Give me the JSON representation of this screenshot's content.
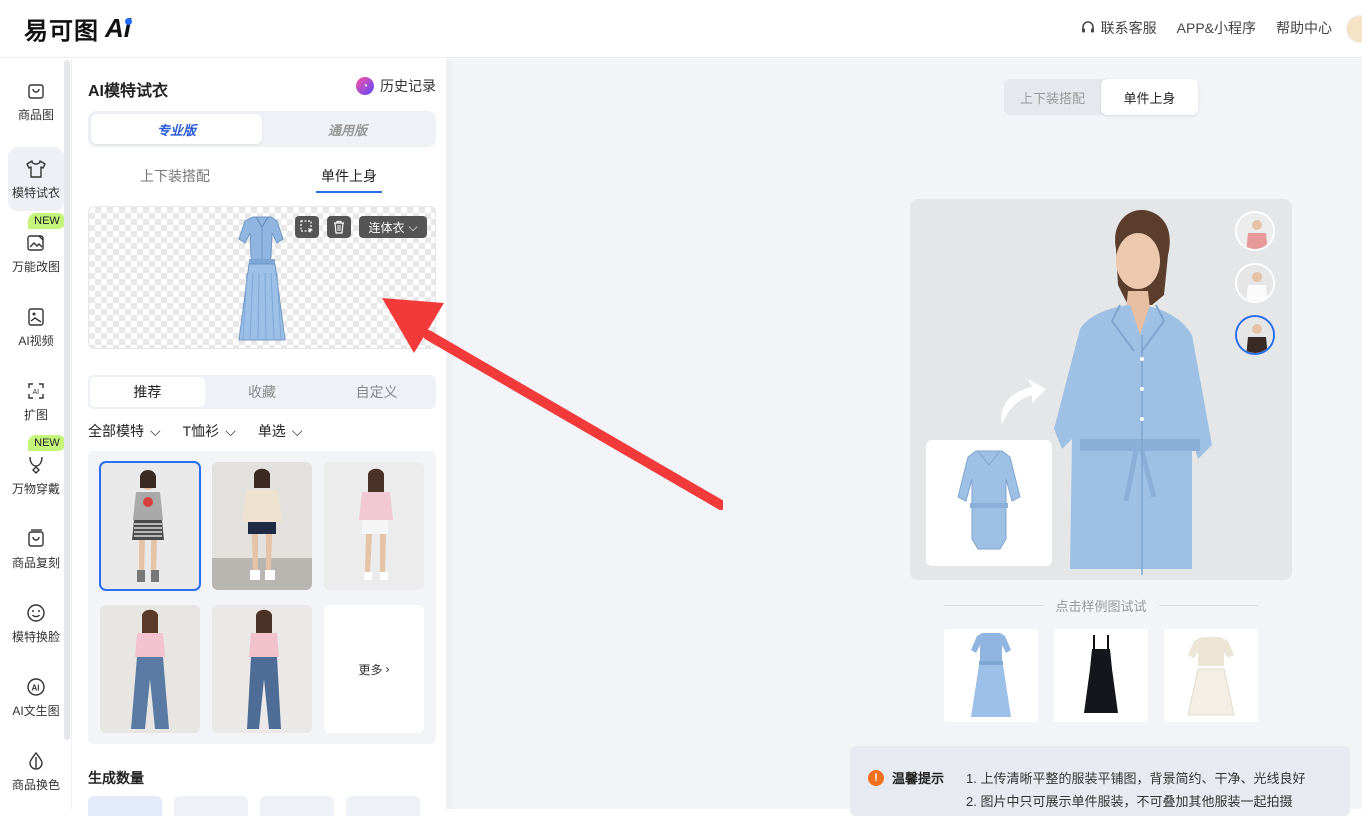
{
  "brand": {
    "logo_text": "易可图",
    "logo_ai": "Ai"
  },
  "topnav": {
    "contact": "联系客服",
    "app": "APP&小程序",
    "help": "帮助中心"
  },
  "sidenav": [
    {
      "label": "商品图",
      "icon": "bag-icon"
    },
    {
      "label": "模特试衣",
      "icon": "shirt-icon",
      "active": true
    },
    {
      "label": "万能改图",
      "icon": "image-edit-icon",
      "badge": "NEW"
    },
    {
      "label": "AI视频",
      "icon": "video-icon"
    },
    {
      "label": "扩图",
      "icon": "expand-icon"
    },
    {
      "label": "万物穿戴",
      "icon": "necklace-icon",
      "badge": "NEW"
    },
    {
      "label": "商品复刻",
      "icon": "copy-bag-icon"
    },
    {
      "label": "模特换脸",
      "icon": "face-icon"
    },
    {
      "label": "AI文生图",
      "icon": "ai-circle-icon"
    },
    {
      "label": "商品换色",
      "icon": "drop-icon"
    }
  ],
  "panel": {
    "title": "AI模特试衣",
    "history": "历史记录",
    "version_tabs": [
      "专业版",
      "通用版"
    ],
    "mode_tabs": [
      "上下装搭配",
      "单件上身"
    ],
    "category": "连体衣",
    "filter_tabs": [
      "推荐",
      "收藏",
      "自定义"
    ],
    "filters": [
      "全部模特",
      "T恤衫",
      "单选"
    ],
    "more": "更多",
    "gen_count": "生成数量"
  },
  "preview": {
    "tabs": [
      "上下装搭配",
      "单件上身"
    ],
    "try_hint": "点击样例图试试",
    "tips_title": "温馨提示",
    "tips": [
      "1. 上传清晰平整的服装平铺图，背景简约、干净、光线良好",
      "2. 图片中只可展示单件服装，不可叠加其他服装一起拍摄"
    ]
  },
  "colors": {
    "accent": "#2a6ef0",
    "arrow": "#f23a3a",
    "new_badge": "#c4f57a"
  }
}
